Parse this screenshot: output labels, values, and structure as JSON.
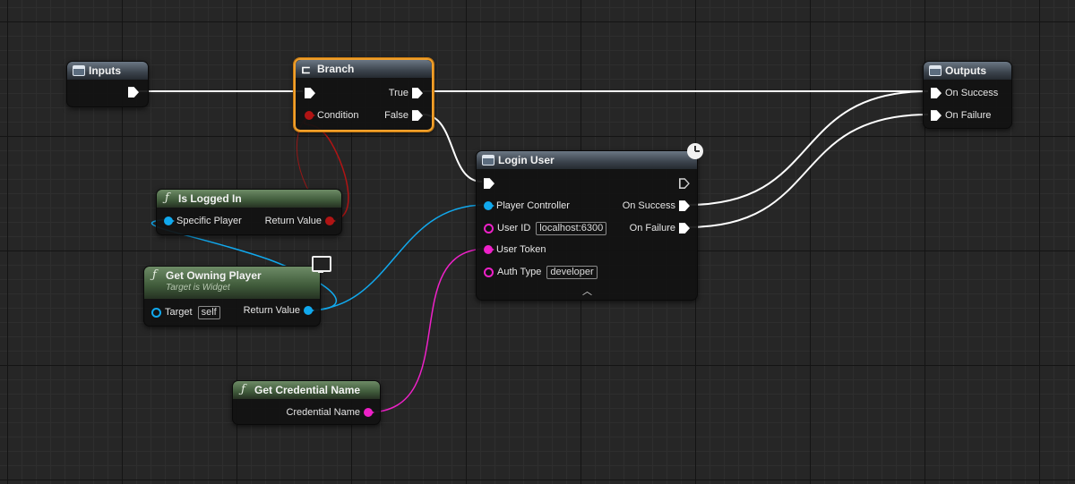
{
  "nodes": {
    "inputs": {
      "title": "Inputs"
    },
    "branch": {
      "title": "Branch",
      "pins": {
        "true": "True",
        "condition": "Condition",
        "false": "False"
      }
    },
    "outputs": {
      "title": "Outputs",
      "pins": {
        "on_success": "On Success",
        "on_failure": "On Failure"
      }
    },
    "login_user": {
      "title": "Login User",
      "pins": {
        "player_controller": "Player Controller",
        "user_id": "User ID",
        "user_id_value": "localhost:6300",
        "user_token": "User Token",
        "auth_type": "Auth Type",
        "auth_type_value": "developer",
        "on_success": "On Success",
        "on_failure": "On Failure"
      }
    },
    "is_logged_in": {
      "title": "Is Logged In",
      "pins": {
        "specific_player": "Specific Player",
        "return_value": "Return Value"
      }
    },
    "get_owning_player": {
      "title": "Get Owning Player",
      "subtitle": "Target is Widget",
      "pins": {
        "target": "Target",
        "target_value": "self",
        "return_value": "Return Value"
      }
    },
    "get_credential_name": {
      "title": "Get Credential Name",
      "pins": {
        "credential_name": "Credential Name"
      }
    }
  },
  "icons": {
    "collapse": "chevron-up",
    "latent": "clock",
    "widget_context": "monitor"
  },
  "colors": {
    "exec": "#ffffff",
    "object_pin": "#11a9ee",
    "string_pin": "#ee21c8",
    "bool_pin": "#b01414",
    "selection": "#f1a02b"
  }
}
